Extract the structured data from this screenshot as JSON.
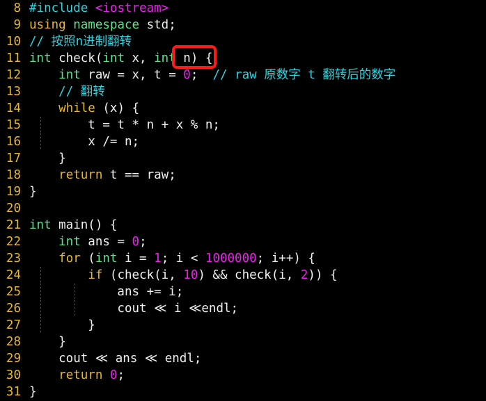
{
  "editor": {
    "background_color": "#000000",
    "gutter_color": "#e8b830",
    "default_text_color": "#f0f0f0",
    "highlight_box_color": "#ff1a1a",
    "first_line_number": 8,
    "last_line_number": 31
  },
  "colors": {
    "keyword": "#e8b830",
    "type": "#5ce68a",
    "number": "#ee20ee",
    "preprocessor": "#2ed3e0",
    "header": "#ee20ee",
    "comment": "#2ed3e0",
    "plain": "#f0f0f0"
  },
  "lines": [
    {
      "number": "8",
      "text": "#include <iostream>"
    },
    {
      "number": "9",
      "text": "using namespace std;"
    },
    {
      "number": "10",
      "text": "// 按照n进制翻转"
    },
    {
      "number": "11",
      "text": "int check(int x, int n) {"
    },
    {
      "number": "12",
      "text": "    int raw = x, t = 0;  // raw 原数字 t 翻转后的数字"
    },
    {
      "number": "13",
      "text": "    // 翻转"
    },
    {
      "number": "14",
      "text": "    while (x) {"
    },
    {
      "number": "15",
      "text": "        t = t * n + x % n;"
    },
    {
      "number": "16",
      "text": "        x /= n;"
    },
    {
      "number": "17",
      "text": "    }"
    },
    {
      "number": "18",
      "text": "    return t == raw;"
    },
    {
      "number": "19",
      "text": "}"
    },
    {
      "number": "20",
      "text": ""
    },
    {
      "number": "21",
      "text": "int main() {"
    },
    {
      "number": "22",
      "text": "    int ans = 0;"
    },
    {
      "number": "23",
      "text": "    for (int i = 1; i < 1000000; i++) {"
    },
    {
      "number": "24",
      "text": "        if (check(i, 10) && check(i, 2)) {"
    },
    {
      "number": "25",
      "text": "            ans += i;"
    },
    {
      "number": "26",
      "text": "            cout << i <<endl;"
    },
    {
      "number": "27",
      "text": "        }"
    },
    {
      "number": "28",
      "text": "    }"
    },
    {
      "number": "29",
      "text": "    cout << ans << endl;"
    },
    {
      "number": "30",
      "text": "    return 0;"
    },
    {
      "number": "31",
      "text": "}"
    }
  ],
  "tokens": {
    "l8": [
      [
        "#include",
        "pre"
      ],
      [
        " ",
        "plain"
      ],
      [
        "<iostream>",
        "hdr"
      ]
    ],
    "l9": [
      [
        "using",
        "kw"
      ],
      [
        " ",
        "plain"
      ],
      [
        "namespace",
        "type"
      ],
      [
        " std;",
        "plain"
      ]
    ],
    "l10": [
      [
        "// 按照n进制翻转",
        "cmt"
      ]
    ],
    "l11": [
      [
        "int",
        "type"
      ],
      [
        " check(",
        "plain"
      ],
      [
        "int",
        "type"
      ],
      [
        " x, ",
        "plain"
      ],
      [
        "int",
        "type"
      ],
      [
        " n) {",
        "plain"
      ]
    ],
    "l12": [
      [
        "    ",
        "plain"
      ],
      [
        "int",
        "type"
      ],
      [
        " raw = x, t = ",
        "plain"
      ],
      [
        "0",
        "num"
      ],
      [
        ";  ",
        "plain"
      ],
      [
        "// raw 原数字 t 翻转后的数字",
        "cmt"
      ]
    ],
    "l13": [
      [
        "    ",
        "plain"
      ],
      [
        "// 翻转",
        "cmt"
      ]
    ],
    "l14": [
      [
        "    ",
        "plain"
      ],
      [
        "while",
        "kw"
      ],
      [
        " (x) {",
        "plain"
      ]
    ],
    "l15": [
      [
        "        t = t * n + x % n;",
        "plain"
      ]
    ],
    "l16": [
      [
        "        x /= n;",
        "plain"
      ]
    ],
    "l17": [
      [
        "    }",
        "plain"
      ]
    ],
    "l18": [
      [
        "    ",
        "plain"
      ],
      [
        "return",
        "kw"
      ],
      [
        " t == raw;",
        "plain"
      ]
    ],
    "l19": [
      [
        "}",
        "plain"
      ]
    ],
    "l20": [
      [
        "",
        "plain"
      ]
    ],
    "l21": [
      [
        "int",
        "type"
      ],
      [
        " main() {",
        "plain"
      ]
    ],
    "l22": [
      [
        "    ",
        "plain"
      ],
      [
        "int",
        "type"
      ],
      [
        " ans = ",
        "plain"
      ],
      [
        "0",
        "num"
      ],
      [
        ";",
        "plain"
      ]
    ],
    "l23": [
      [
        "    ",
        "plain"
      ],
      [
        "for",
        "kw"
      ],
      [
        " (",
        "plain"
      ],
      [
        "int",
        "type"
      ],
      [
        " i = ",
        "plain"
      ],
      [
        "1",
        "num"
      ],
      [
        "; i < ",
        "plain"
      ],
      [
        "1000000",
        "num"
      ],
      [
        "; i++) {",
        "plain"
      ]
    ],
    "l24": [
      [
        "        ",
        "plain"
      ],
      [
        "if",
        "kw"
      ],
      [
        " (check(i, ",
        "plain"
      ],
      [
        "10",
        "num"
      ],
      [
        ") && check(i, ",
        "plain"
      ],
      [
        "2",
        "num"
      ],
      [
        ")) {",
        "plain"
      ]
    ],
    "l25": [
      [
        "            ans += i;",
        "plain"
      ]
    ],
    "l26": [
      [
        "            cout ",
        "plain"
      ],
      [
        "≪",
        "plain"
      ],
      [
        " i ",
        "plain"
      ],
      [
        "≪",
        "plain"
      ],
      [
        "endl;",
        "plain"
      ]
    ],
    "l27": [
      [
        "        }",
        "plain"
      ]
    ],
    "l28": [
      [
        "    }",
        "plain"
      ]
    ],
    "l29": [
      [
        "    cout ",
        "plain"
      ],
      [
        "≪",
        "plain"
      ],
      [
        " ans ",
        "plain"
      ],
      [
        "≪",
        "plain"
      ],
      [
        " endl;",
        "plain"
      ]
    ],
    "l30": [
      [
        "    ",
        "plain"
      ],
      [
        "return",
        "kw"
      ],
      [
        " ",
        "plain"
      ],
      [
        "0",
        "num"
      ],
      [
        ";",
        "plain"
      ]
    ],
    "l31": [
      [
        "}",
        "plain"
      ]
    ]
  },
  "indent_guides": {
    "level1_lines": [
      "15",
      "16",
      "24",
      "25",
      "26",
      "27"
    ],
    "level2_lines": [
      "25",
      "26"
    ]
  },
  "highlight": {
    "label": "int n",
    "line_number": "11",
    "color": "#ff1a1a"
  }
}
